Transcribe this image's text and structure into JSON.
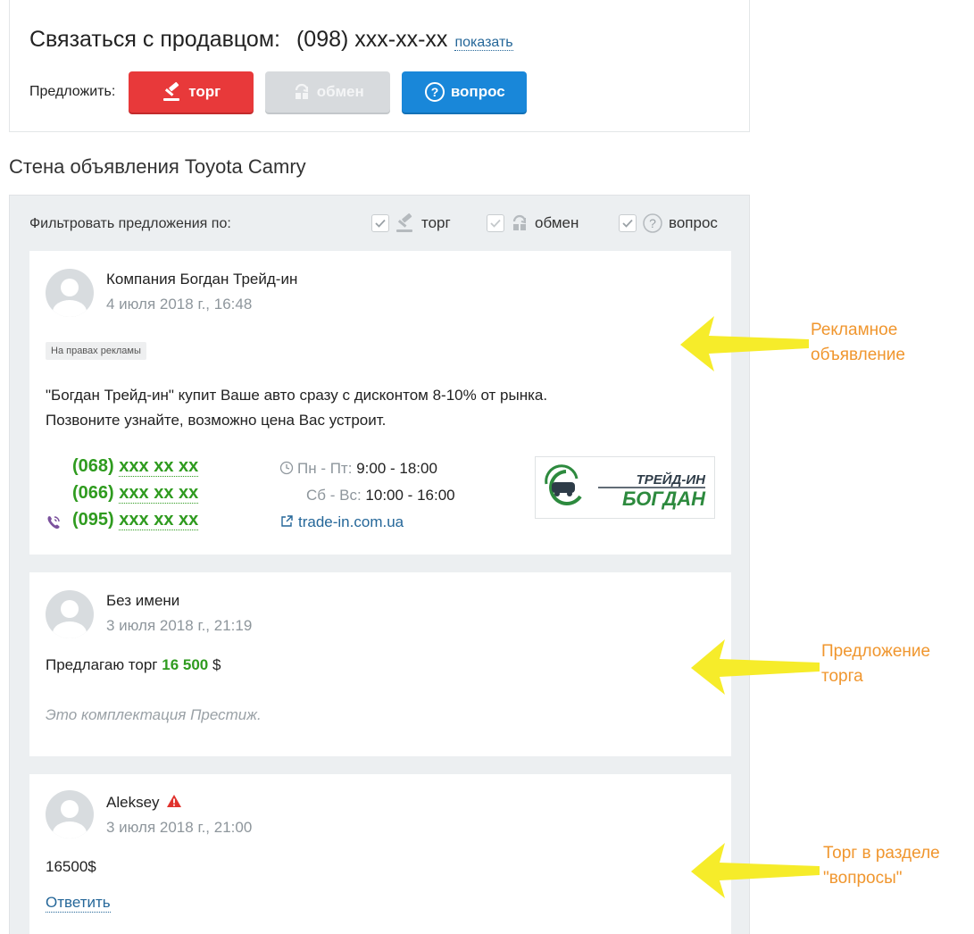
{
  "contact": {
    "label": "Связаться с продавцом:",
    "phone": "(098) xxx-xx-xx",
    "show_link": "показать",
    "offer_label": "Предложить:",
    "buttons": {
      "torg": "торг",
      "obmen": "обмен",
      "vopros": "вопрос"
    }
  },
  "wall": {
    "title": "Стена объявления Toyota Camry",
    "filter_label": "Фильтровать предложения по:",
    "filters": {
      "torg": "торг",
      "obmen": "обмен",
      "vopros": "вопрос"
    }
  },
  "ad_post": {
    "author": "Компания Богдан Трейд-ин",
    "date": "4 июля 2018 г., 16:48",
    "badge": "На правах рекламы",
    "text_line1": "\"Богдан Трейд-ин\" купит Ваше авто сразу с дисконтом 8-10% от рынка.",
    "text_line2": "Позвоните узнайте, возможно цена Вас устроит.",
    "phones": [
      {
        "code": "(068)",
        "number": "xxx xx xx"
      },
      {
        "code": "(066)",
        "number": "xxx xx xx"
      },
      {
        "code": "(095)",
        "number": "xxx xx xx"
      }
    ],
    "hours": {
      "weekdays_label": "Пн - Пт:",
      "weekdays_value": "9:00 - 18:00",
      "weekend_label": "Сб - Вс:",
      "weekend_value": "10:00 - 16:00"
    },
    "site": "trade-in.com.ua",
    "logo": {
      "line1": "ТРЕЙД-ИН",
      "line2": "БОГДАН"
    }
  },
  "torg_post": {
    "author": "Без имени",
    "date": "3 июля 2018 г., 21:19",
    "offer_prefix": "Предлагаю торг",
    "price": "16 500",
    "currency": "$",
    "comment": "Это комплектация Престиж."
  },
  "question_post": {
    "author": "Aleksey",
    "date": "3 июля 2018 г., 21:00",
    "text": "16500$",
    "reply": "Ответить"
  },
  "annotations": {
    "ad": [
      "Рекламное",
      "объявление"
    ],
    "torg": [
      "Предложение",
      "торга"
    ],
    "question": [
      "Торг в разделе",
      "\"вопросы\""
    ]
  },
  "colors": {
    "torg_button": "#e8393a",
    "obmen_button": "#d7dadd",
    "vopros_button": "#1987d9",
    "price_green": "#2f9b1f",
    "link_blue": "#256799",
    "annotation_orange": "#f0962e",
    "arrow_yellow": "#f6ec2a"
  }
}
